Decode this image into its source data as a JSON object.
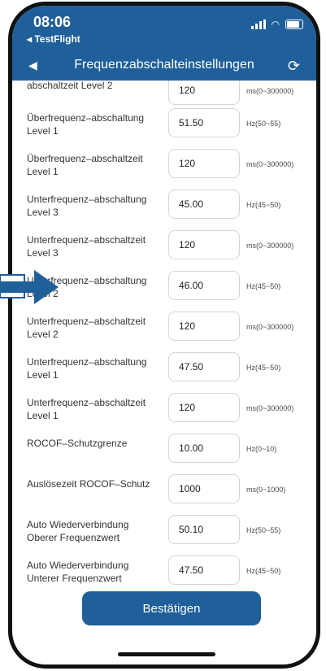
{
  "status": {
    "time": "08:06",
    "back_app": "TestFlight"
  },
  "nav": {
    "title": "Frequenzabschalteinstellungen"
  },
  "rows": [
    {
      "label": "abschaltzeit Level 2",
      "value": "120",
      "unit": "ms(0~300000)"
    },
    {
      "label": "Überfrequenz–abschaltung Level 1",
      "value": "51.50",
      "unit": "Hz(50~55)"
    },
    {
      "label": "Überfrequenz–abschaltzeit Level 1",
      "value": "120",
      "unit": "ms(0~300000)"
    },
    {
      "label": "Unterfrequenz–abschaltung Level 3",
      "value": "45.00",
      "unit": "Hz(45~50)"
    },
    {
      "label": "Unterfrequenz–abschaltzeit Level 3",
      "value": "120",
      "unit": "ms(0~300000)"
    },
    {
      "label": "Unterfrequenz–abschaltung Level 2",
      "value": "46.00",
      "unit": "Hz(45~50)"
    },
    {
      "label": "Unterfrequenz–abschaltzeit Level 2",
      "value": "120",
      "unit": "ms(0~300000)"
    },
    {
      "label": "Unterfrequenz–abschaltung Level 1",
      "value": "47.50",
      "unit": "Hz(45~50)"
    },
    {
      "label": "Unterfrequenz–abschaltzeit Level 1",
      "value": "120",
      "unit": "ms(0~300000)"
    },
    {
      "label": "ROCOF–Schutzgrenze",
      "value": "10.00",
      "unit": "Hz(0~10)"
    },
    {
      "label": "Auslösezeit ROCOF–Schutz",
      "value": "1000",
      "unit": "ms(0~1000)"
    },
    {
      "label": "Auto Wiederverbindung Oberer Frequenzwert",
      "value": "50.10",
      "unit": "Hz(50~55)"
    },
    {
      "label": "Auto Wiederverbindung Unterer Frequenzwert",
      "value": "47.50",
      "unit": "Hz(45~50)"
    }
  ],
  "confirm_label": "Bestätigen",
  "colors": {
    "accent": "#1f5f9a"
  }
}
